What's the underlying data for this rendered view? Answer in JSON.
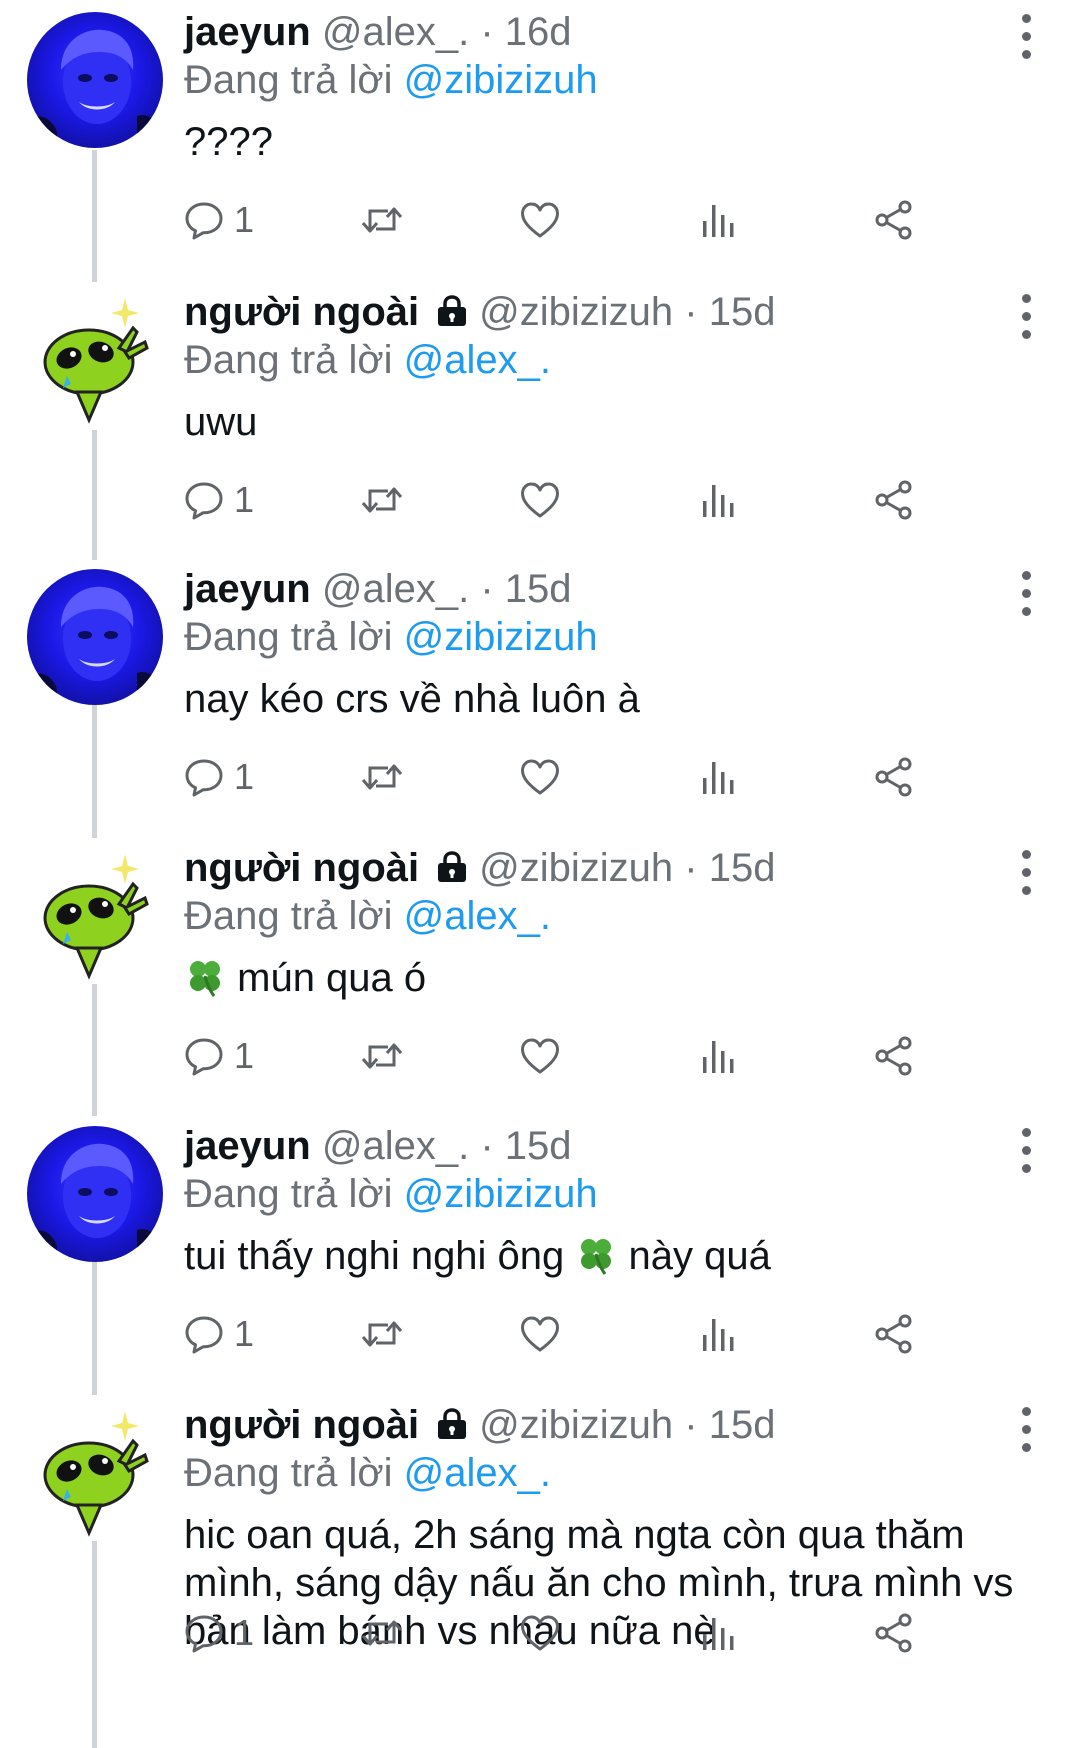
{
  "tweets": [
    {
      "name": "jaeyun",
      "handle": "@alex_.",
      "time": "· 16d",
      "locked": false,
      "avatar": "jaeyun-avatar",
      "replying_prefix": "Đang trả lời",
      "replying_to": "@zibizizuh",
      "text_before": "????",
      "emoji": "",
      "text_after": "",
      "reply_count": "1"
    },
    {
      "name": "người ngoài",
      "handle": "@zibizizuh",
      "time": "· 15d",
      "locked": true,
      "avatar": "alien-avatar",
      "replying_prefix": "Đang trả lời",
      "replying_to": "@alex_.",
      "text_before": "uwu",
      "emoji": "",
      "text_after": "",
      "reply_count": "1"
    },
    {
      "name": "jaeyun",
      "handle": "@alex_.",
      "time": "· 15d",
      "locked": false,
      "avatar": "jaeyun-avatar",
      "replying_prefix": "Đang trả lời",
      "replying_to": "@zibizizuh",
      "text_before": "nay kéo crs về nhà luôn à",
      "emoji": "",
      "text_after": "",
      "reply_count": "1"
    },
    {
      "name": "người ngoài",
      "handle": "@zibizizuh",
      "time": "· 15d",
      "locked": true,
      "avatar": "alien-avatar",
      "replying_prefix": "Đang trả lời",
      "replying_to": "@alex_.",
      "text_before": "",
      "emoji": "four-leaf-clover",
      "text_after": "mún qua ó",
      "reply_count": "1"
    },
    {
      "name": "jaeyun",
      "handle": "@alex_.",
      "time": "· 15d",
      "locked": false,
      "avatar": "jaeyun-avatar",
      "replying_prefix": "Đang trả lời",
      "replying_to": "@zibizizuh",
      "text_before": "tui thấy nghi nghi ông",
      "emoji": "four-leaf-clover",
      "text_after": "này quá",
      "reply_count": "1"
    },
    {
      "name": "người ngoài",
      "handle": "@zibizizuh",
      "time": "· 15d",
      "locked": true,
      "avatar": "alien-avatar",
      "replying_prefix": "Đang trả lời",
      "replying_to": "@alex_.",
      "text_before": "hic oan quá, 2h sáng mà ngta còn qua thăm mình, sáng dậy nấu ăn cho mình, trưa mình vs bản làm bánh vs nhau nữa nè",
      "emoji": "",
      "text_after": "",
      "reply_count": "1"
    }
  ],
  "icons": {
    "reply": "speech-bubble-icon",
    "retweet": "retweet-icon",
    "like": "heart-icon",
    "views": "bar-chart-icon",
    "share": "share-icon",
    "more": "more-vertical-icon",
    "lock": "lock-icon"
  },
  "colors": {
    "mention": "#1d9bf0",
    "secondary_text": "#6b7176",
    "icon": "#606468",
    "thread_line": "#d0d4d8",
    "jaeyun_avatar": "#1b18e6",
    "alien_green": "#8fd11f"
  }
}
